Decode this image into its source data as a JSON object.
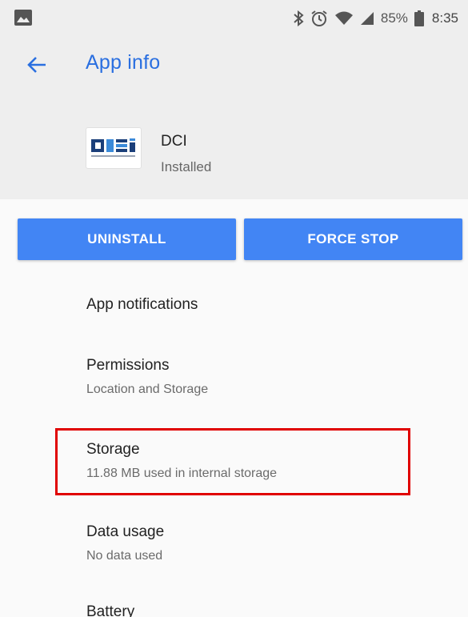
{
  "status_bar": {
    "left_icon": "image-notification-icon",
    "icons": [
      "bluetooth-icon",
      "alarm-icon",
      "wifi-icon",
      "cell-signal-icon",
      "battery-icon"
    ],
    "battery_percent": "85%",
    "time": "8:35"
  },
  "app_bar": {
    "back_icon": "arrow-back-icon",
    "title": "App info"
  },
  "app": {
    "name": "DCI",
    "status": "Installed",
    "icon_text": "DCi",
    "icon_caption": "DIRECT CARE INNOVATIONS"
  },
  "buttons": {
    "uninstall": "UNINSTALL",
    "force_stop": "FORCE STOP"
  },
  "settings": [
    {
      "title": "App notifications",
      "summary": ""
    },
    {
      "title": "Permissions",
      "summary": "Location and Storage"
    },
    {
      "title": "Storage",
      "summary": "11.88 MB used in internal storage"
    },
    {
      "title": "Data usage",
      "summary": "No data used"
    },
    {
      "title": "Battery",
      "summary": ""
    }
  ],
  "colors": {
    "accent": "#2a6fe0",
    "button": "#4285f4",
    "highlight": "#e00000",
    "header_bg": "#eeeeee"
  }
}
